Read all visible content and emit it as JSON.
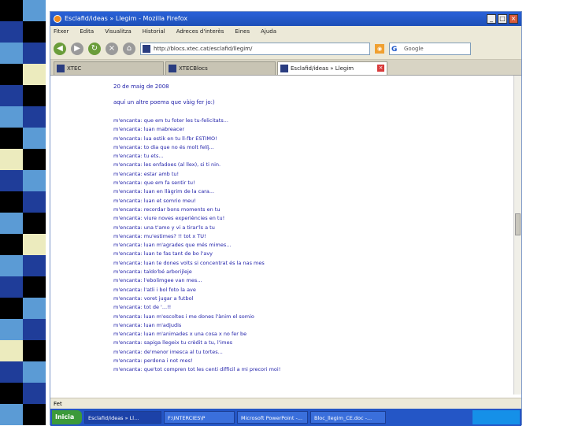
{
  "window": {
    "title": "Esclafid/ideas » Llegim - Mozilla Firefox",
    "menu": [
      "Fitxer",
      "Edita",
      "Visualitza",
      "Historial",
      "Adreces d'interès",
      "Eines",
      "Ajuda"
    ],
    "url": "http://blocs.xtec.cat/esclafid/llegim/",
    "search_placeholder": "Google"
  },
  "tabs": [
    {
      "label": "XTEC"
    },
    {
      "label": "XTECBlocs"
    },
    {
      "label": "Esclafid/ideas » Llegim"
    }
  ],
  "content": {
    "date": "20 de maig de 2008",
    "intro": "aquí un altre poema que vàig fer jo:)",
    "lines": [
      "m'encanta: que em tu foter les tu-felicitats...",
      "m'encanta: luan mabreacer",
      "m'encanta: lua estik en tu ll-fbr ESTIMO!",
      "m'encanta: to dia que no és molt felíj...",
      "m'encanta: tu ets...",
      "m'encanta: les enfadoes (al llex), si ti nin.",
      "m'encanta: estar amb tu!",
      "m'encanta: que em fa sentir tu!",
      "m'encanta: luan en llàgrim de la cara...",
      "m'encanta: luan et somrio meu!",
      "m'encanta: recordar bons moments en tu",
      "m'encanta: viure noves experiències en tu!",
      "m'encanta: una t'amo y vi a tirar'ls a tu",
      "m'encanta: mu'estimes? !! tot x TU!",
      "m'encanta: luan m'agrades que més mimes...",
      "m'encanta: luan te fas tant de bo l'avy",
      "m'encanta: luan te dones volts si concentrat és la nas mes",
      "m'encanta: taldo'bé arborijleje",
      "m'encanta: l'ebolimgee van mes...",
      "m'encanta: l'atli i bol foto la ave",
      "m'encanta: voret jugar a futbol",
      "m'encanta: tot de '...!!",
      "m'encanta: luan m'escoltes i me dones l'ànim el somio",
      "m'encanta: luan m'adjudis",
      "m'encanta: luan m'animades x una cosa x no fer be",
      "m'encanta: sapiga llegeix tu crèdit a tu, l'imes",
      "m'encanta: de'menor imesca al tu tortes...",
      "m'encanta: perdona i not mes!",
      "m'encanta: que'tot compren tot les centi difficil a mi precori moi!"
    ]
  },
  "status": "Fet",
  "taskbar": {
    "start": "Inicia",
    "items": [
      "Esclafid/ideas » Ll...",
      "F:\\INTERCIES\\P",
      "Microsoft PowerPoint -...",
      "Bloc_llegim_CE.doc -..."
    ]
  }
}
